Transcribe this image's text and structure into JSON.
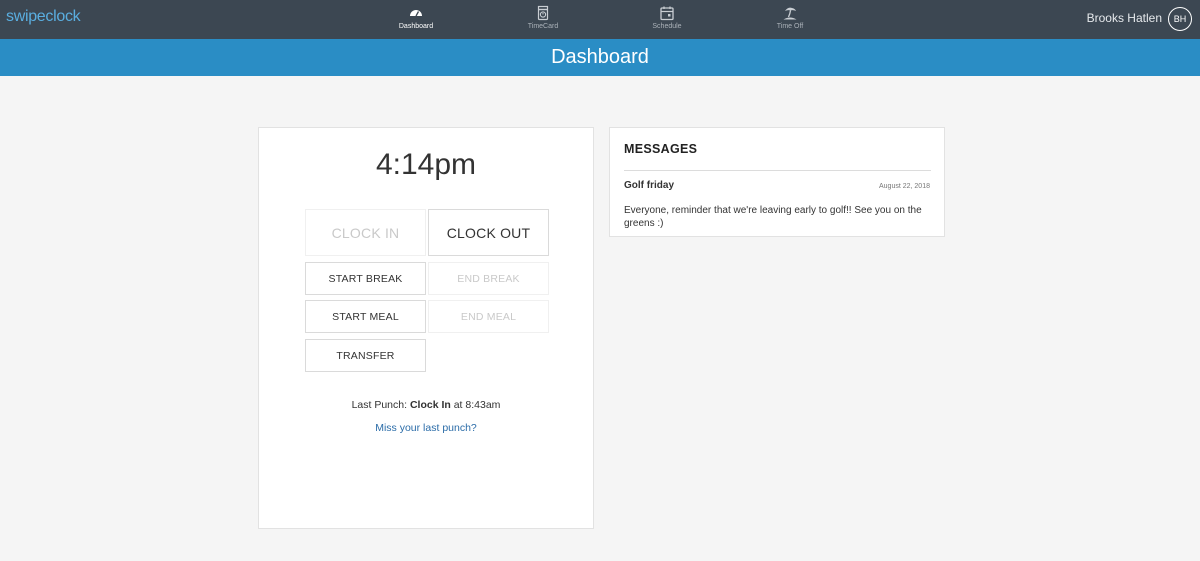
{
  "header": {
    "logo": "swipeclock",
    "nav": [
      {
        "label": "Dashboard",
        "icon": "dashboard-icon",
        "active": true
      },
      {
        "label": "TimeCard",
        "icon": "timecard-icon",
        "active": false
      },
      {
        "label": "Schedule",
        "icon": "calendar-icon",
        "active": false
      },
      {
        "label": "Time Off",
        "icon": "island-icon",
        "active": false
      }
    ],
    "user_name": "Brooks Hatlen",
    "user_initials": "BH"
  },
  "title_bar": {
    "title": "Dashboard"
  },
  "clock": {
    "time": "4:14pm",
    "buttons": {
      "clock_in": {
        "label": "CLOCK IN",
        "enabled": false
      },
      "clock_out": {
        "label": "CLOCK OUT",
        "enabled": true
      },
      "start_break": {
        "label": "START BREAK",
        "enabled": true
      },
      "end_break": {
        "label": "END BREAK",
        "enabled": false
      },
      "start_meal": {
        "label": "START MEAL",
        "enabled": true
      },
      "end_meal": {
        "label": "END MEAL",
        "enabled": false
      },
      "transfer": {
        "label": "TRANSFER",
        "enabled": true
      }
    },
    "last_punch": {
      "prefix": "Last Punch:",
      "type": "Clock In",
      "suffix": "at 8:43am"
    },
    "miss_link": "Miss your last punch?"
  },
  "messages": {
    "heading": "MESSAGES",
    "items": [
      {
        "subject": "Golf friday",
        "date": "August 22, 2018",
        "body": "Everyone, reminder that we're leaving early to golf!! See you on the greens :)"
      }
    ]
  },
  "colors": {
    "topbar": "#3c4752",
    "titlebar": "#2a8dc5",
    "link": "#2b6ca8",
    "logo": "#5aaee0"
  }
}
